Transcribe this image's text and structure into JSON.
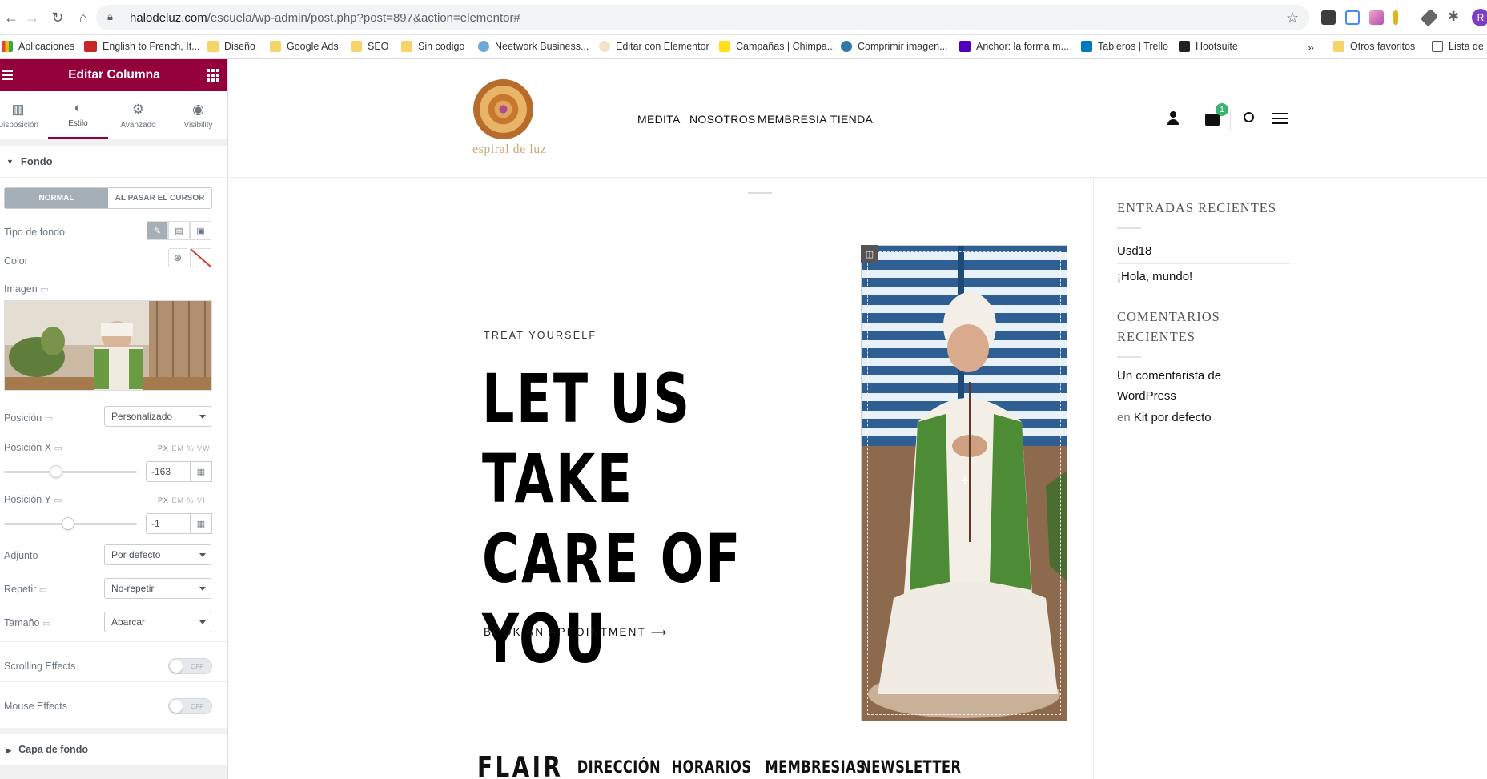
{
  "browser": {
    "url_host": "halodeluz.com",
    "url_path": "/escuela/wp-admin/post.php?post=897&action=elementor#",
    "bookmarks": [
      {
        "label": "Aplicaciones",
        "icon": "apps-grid-icon"
      },
      {
        "label": "English to French, It...",
        "icon": "reverso-icon"
      },
      {
        "label": "Diseño",
        "icon": "folder-icon"
      },
      {
        "label": "Google Ads",
        "icon": "folder-icon"
      },
      {
        "label": "SEO",
        "icon": "folder-icon"
      },
      {
        "label": "Sin codigo",
        "icon": "folder-icon"
      },
      {
        "label": "Neetwork Business...",
        "icon": "neetwork-icon"
      },
      {
        "label": "Editar con Elementor",
        "icon": "elementor-icon"
      },
      {
        "label": "Campañas | Chimpa...",
        "icon": "mailchimp-icon"
      },
      {
        "label": "Comprimir imagen...",
        "icon": "compress-icon"
      },
      {
        "label": "Anchor: la forma m...",
        "icon": "anchor-icon"
      },
      {
        "label": "Tableros | Trello",
        "icon": "trello-icon"
      },
      {
        "label": "Hootsuite",
        "icon": "hootsuite-icon"
      }
    ],
    "more": "»",
    "other_bookmarks": "Otros favoritos",
    "reading_list": "Lista de l"
  },
  "panel": {
    "title": "Editar Columna",
    "tabs": [
      {
        "label": "Disposición",
        "icon": "layout-icon"
      },
      {
        "label": "Estilo",
        "icon": "style-icon"
      },
      {
        "label": "Avanzado",
        "icon": "gear-icon"
      },
      {
        "label": "Visibility",
        "icon": "eye-icon"
      }
    ],
    "section_fondo": "Fondo",
    "state_normal": "NORMAL",
    "state_hover": "AL PASAR EL CURSOR",
    "tipo_fondo": "Tipo de fondo",
    "color": "Color",
    "imagen": "Imagen",
    "posicion": {
      "label": "Posición",
      "value": "Personalizado"
    },
    "posicion_x": {
      "label": "Posición X",
      "value": "-163",
      "units": [
        "PX",
        "EM",
        "%",
        "VW"
      ],
      "slider": 0.39
    },
    "posicion_y": {
      "label": "Posición Y",
      "value": "-1",
      "units": [
        "PX",
        "EM",
        "%",
        "VH"
      ],
      "slider": 0.48
    },
    "adjunto": {
      "label": "Adjunto",
      "value": "Por defecto"
    },
    "repetir": {
      "label": "Repetir",
      "value": "No-repetir"
    },
    "tamano": {
      "label": "Tamaño",
      "value": "Abarcar"
    },
    "scrolling": {
      "label": "Scrolling Effects",
      "state": "OFF"
    },
    "mouse": {
      "label": "Mouse Effects",
      "state": "OFF"
    },
    "section_capa": "Capa de fondo"
  },
  "site": {
    "logo_text": "espiral de luz",
    "nav": [
      "MEDITA",
      "NOSOTROS",
      "MEMBRESIA",
      "TIENDA"
    ],
    "cart_count": "1",
    "tagline": "TREAT YOURSELF",
    "headline": "LET US TAKE CARE OF YOU",
    "cta": "BOOK AN APPOINTMENT ⟶",
    "footer_nav": [
      "FLAIR",
      "DIRECCIÓN",
      "HORARIOS",
      "MEMBRESIAS",
      "NEWSLETTER"
    ],
    "sidebar": {
      "recent_title": "ENTRADAS RECIENTES",
      "recent": [
        "Usd18",
        "¡Hola, mundo!"
      ],
      "comments_title": "COMENTARIOS RECIENTES",
      "comment_author": "Un comentarista de WordPress",
      "comment_en": "en",
      "comment_post": "Kit por defecto"
    }
  },
  "colors": {
    "elementor_brand": "#93003c",
    "accent_green": "#3cb371"
  }
}
